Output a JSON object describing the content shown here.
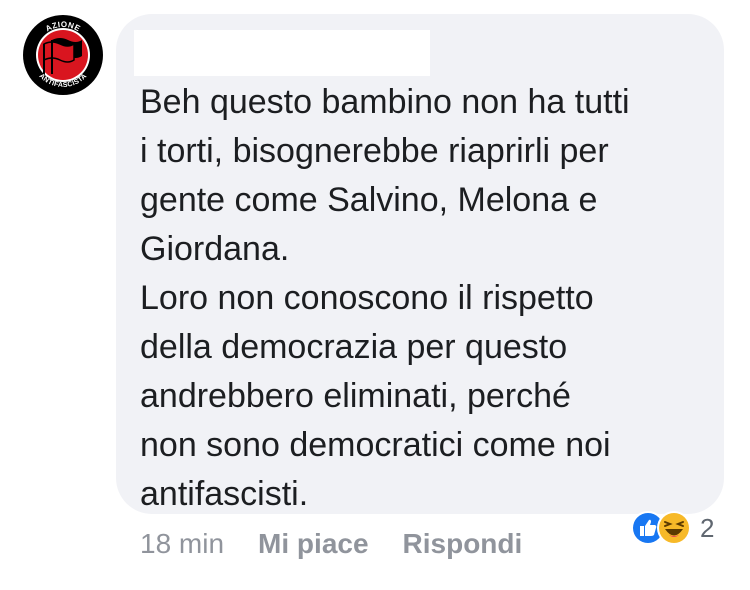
{
  "comment": {
    "author_name": "",
    "avatar_icon": "antifascist-flag-logo",
    "avatar_text_top": "AZIONE",
    "avatar_text_bottom": "ANTIFASCISTA",
    "text": "Beh questo bambino non ha tutti\ni torti, bisognerebbe riaprirli per\ngente come Salvino, Melona e\nGiordana.\nLoro non conoscono il rispetto\ndella democrazia per questo\nandrebbero eliminati, perché\nnon sono democratici come noi\nantifascisti."
  },
  "actions": {
    "time": "18 min",
    "like_label": "Mi piace",
    "reply_label": "Rispondi"
  },
  "reactions": {
    "icons": [
      "like-icon",
      "haha-icon"
    ],
    "count": "2"
  },
  "colors": {
    "bubble_bg": "#f1f2f6",
    "text": "#1c1e21",
    "meta": "#90949c",
    "like_blue": "#1877f2",
    "haha_yellow": "#f7b928",
    "logo_red": "#d9151f"
  }
}
